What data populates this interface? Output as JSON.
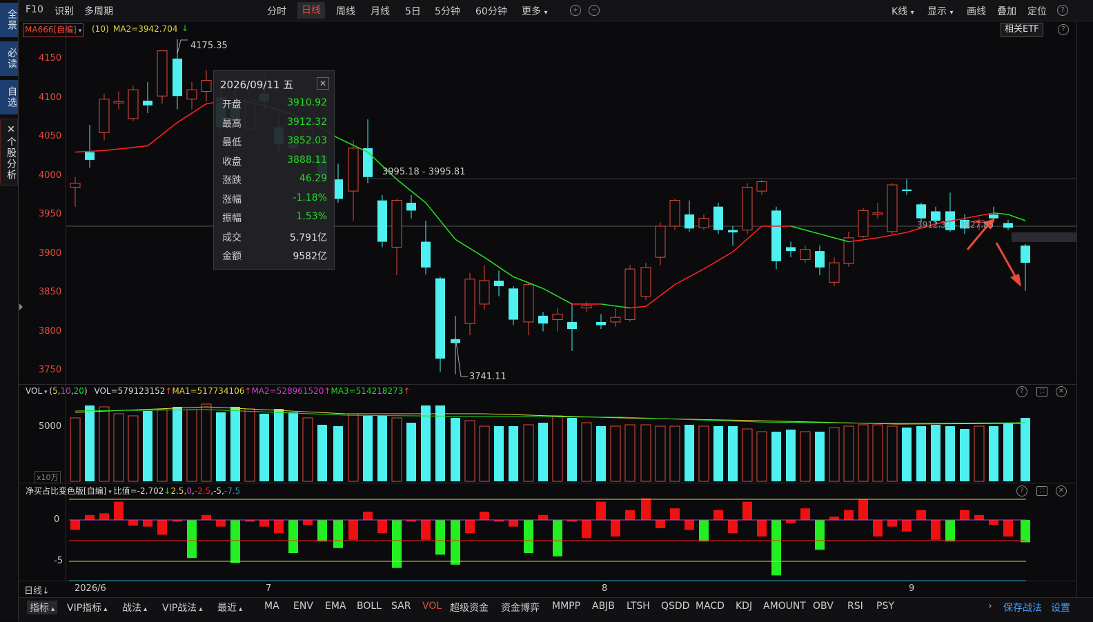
{
  "left_sidebar": {
    "overview": "全景",
    "must_read": "必读",
    "watchlist": "自选",
    "stock_analysis_close": "✕",
    "stock_analysis": "个股分析"
  },
  "top_toolbar": {
    "f10": "F10",
    "identify": "识别",
    "multi_period": "多周期",
    "periods": [
      "分时",
      "日线",
      "周线",
      "月线",
      "5日",
      "5分钟",
      "60分钟",
      "更多"
    ],
    "active_period": "日线",
    "right": {
      "kline": "K线",
      "display": "显示",
      "draw": "画线",
      "overlay": "叠加",
      "locate": "定位",
      "help": "?"
    }
  },
  "main_panel": {
    "indicator": "MA666[自编]",
    "param": "(10)",
    "ma2": "MA2=3942.704",
    "ma2_arrow": "↓",
    "related_etf": "相关ETF",
    "price_high_label": "4175.35",
    "price_low_label": "3741.11",
    "range_label": "3995.18 - 3995.81",
    "current_label": "3912.32 - 3927.85",
    "y_ticks": [
      "4150",
      "4100",
      "4050",
      "4000",
      "3950",
      "3900",
      "3850",
      "3800",
      "3750"
    ]
  },
  "tooltip": {
    "date": "2026/09/11 五",
    "close_btn": "✕",
    "rows": [
      {
        "label": "开盘",
        "value": "3910.92"
      },
      {
        "label": "最高",
        "value": "3912.32"
      },
      {
        "label": "最低",
        "value": "3852.03"
      },
      {
        "label": "收盘",
        "value": "3888.11"
      },
      {
        "label": "涨跌",
        "value": "46.29"
      },
      {
        "label": "涨幅",
        "value": "-1.18%"
      },
      {
        "label": "振幅",
        "value": "1.53%"
      },
      {
        "label": "成交",
        "value": "5.791亿"
      },
      {
        "label": "金额",
        "value": "9582亿"
      }
    ]
  },
  "vol_panel": {
    "name": "VOL",
    "params_open": "(",
    "p1": "5",
    "p2": "10",
    "p3": "20",
    "params_close": ")",
    "vol": "VOL=579123152",
    "ma1": "MA1=517734106",
    "ma2": "MA2=528961520",
    "ma3": "MA3=514218273",
    "arrow": "↑",
    "y_tick": "5000",
    "unit": "x10万"
  },
  "net_panel": {
    "name": "净买占比变色版[自编]",
    "ratio": "比值=-2.702",
    "ratio_arrow": "↓",
    "p1": "2.5",
    "p2": "0",
    "p3": "-2.5",
    "p4": "-5",
    "p5": "-7.5",
    "y_ticks": [
      "0",
      "-5"
    ]
  },
  "x_axis": {
    "period_label": "日线",
    "labels": [
      "2026/6",
      "7",
      "8",
      "9"
    ]
  },
  "bottom_bar": {
    "tabs": [
      "指标",
      "VIP指标",
      "战法",
      "VIP战法",
      "最近"
    ],
    "indicators": [
      "MA",
      "ENV",
      "EMA",
      "BOLL",
      "SAR",
      "VOL",
      "超级资金",
      "资金博弈",
      "MMPP",
      "ABJB",
      "LTSH",
      "QSDD",
      "MACD",
      "KDJ",
      "AMOUNT",
      "OBV",
      "RSI",
      "PSY"
    ],
    "active_indicator": "VOL",
    "more": "›",
    "save": "保存战法",
    "settings": "设置"
  },
  "colors": {
    "up": "#e84a3a",
    "down": "#4ff0f0",
    "ma_red": "#ff2020",
    "ma_green": "#22dd22",
    "yellow": "#e8d43a",
    "magenta": "#d040d0",
    "bg": "#0b0b0d"
  }
}
